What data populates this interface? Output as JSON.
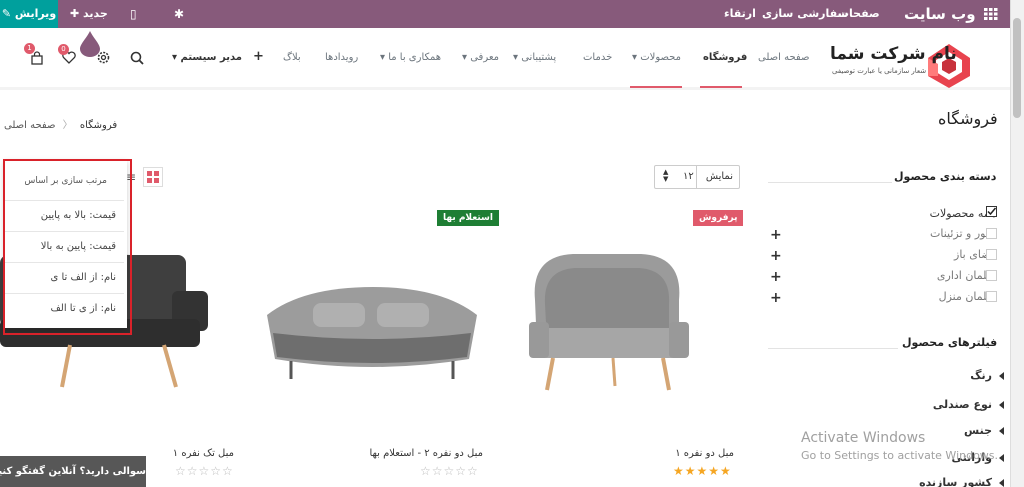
{
  "topbar": {
    "edit_label": "✎ ویرایش",
    "new_label": "✚ جدید",
    "mobile_icon": "▯",
    "debug_icon": "✱",
    "site_title": "وب سایت",
    "menu": [
      "صفحات",
      "سفارشی سازی",
      "ارتقاء"
    ],
    "apps_icon": "grid-icon"
  },
  "header": {
    "company_name": "نام شرکت شما",
    "tagline": "شعار سازمانی یا عبارت توصیفی",
    "nav": [
      {
        "label": "صفحه اصلی",
        "active": false
      },
      {
        "label": "فروشگاه",
        "active": true
      },
      {
        "label": "محصولات ▾",
        "active": false
      },
      {
        "label": "خدمات",
        "active": false
      },
      {
        "label": "پشتیبانی ▾",
        "active": false
      },
      {
        "label": "معرفی ▾",
        "active": false
      },
      {
        "label": "همکاری با ما ▾",
        "active": false
      },
      {
        "label": "رویدادها",
        "active": false
      },
      {
        "label": "بلاگ",
        "active": false
      },
      {
        "label": "+",
        "active": false
      },
      {
        "label": "مدیر سیستم ▾",
        "active": false
      }
    ],
    "cart_count": "1",
    "wishlist_count": "0"
  },
  "breadcrumb": {
    "home": "صفحه اصلی",
    "current": "فروشگاه"
  },
  "page_title": "فروشگاه",
  "toolbar": {
    "show_label": "نمایش",
    "ppg_value": "۱۲",
    "sort_title": "مرتب سازی بر اساس",
    "sort_options": [
      "قیمت: بالا به پایین",
      "قیمت: پایین به بالا",
      "نام: از الف تا ی",
      "نام: از ی تا الف"
    ]
  },
  "sidebar": {
    "categories_title": "دسته بندی محصول",
    "categories": [
      {
        "label": "همه محصولات",
        "checked": true
      },
      {
        "label": "دکور و تزئینات",
        "checked": false
      },
      {
        "label": "فضای باز",
        "checked": false
      },
      {
        "label": "مبلمان اداری",
        "checked": false
      },
      {
        "label": "مبلمان منزل",
        "checked": false
      }
    ],
    "filters_title": "فیلترهای محصول",
    "filters": [
      "رنگ",
      "نوع صندلی",
      "جنس",
      "وارانتی",
      "کشور سازنده"
    ]
  },
  "products": [
    {
      "name": "مبل دو نفره ۱",
      "ribbon": "پرفروش",
      "stars": "★★★★★",
      "rated": true
    },
    {
      "name": "مبل دو نفره ۲ - استعلام بها",
      "ribbon": "استعلام بها",
      "stars": "☆☆☆☆☆",
      "rated": false
    },
    {
      "name": "مبل تک نفره ۱",
      "ribbon": "",
      "stars": "☆☆☆☆☆",
      "rated": false
    }
  ],
  "chat_label": "سوالی دارید؟ آنلاین گفتگو کنید.",
  "watermark": {
    "title": "Activate Windows",
    "subtitle": "Go to Settings to activate Windows."
  },
  "colors": {
    "topbar": "#875a7b",
    "edit": "#00a09d",
    "accent": "#e05a6b",
    "highlight": "#d9222a"
  }
}
